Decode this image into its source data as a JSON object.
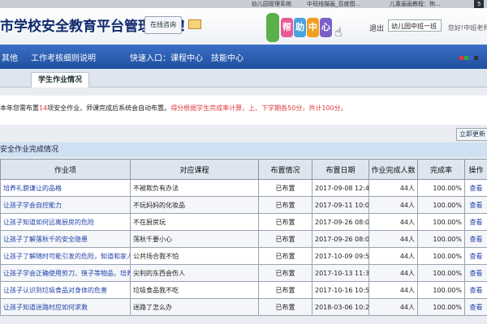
{
  "browser": {
    "tabs": [
      {
        "label": "幼儿园管理系统"
      },
      {
        "label": "中班线描画_百度图..."
      },
      {
        "label": "儿童画画教程：狗..."
      },
      {
        "label": "5"
      }
    ]
  },
  "header": {
    "title": "市学校安全教育平台管理系统！",
    "consult_label": "在线咨询",
    "help_letters": [
      "帮",
      "助",
      "中",
      "心"
    ],
    "logout_label": "退出",
    "kindergarten_select": "幼儿园中班一班",
    "welcome_text": "您好!中班老师"
  },
  "nav": {
    "items": [
      "其他",
      "工作考核细则说明"
    ],
    "quick_entry": "快速入口：课程中心　技能中心",
    "dot_colors": [
      "#e33",
      "#3a3",
      "#36c",
      "#333"
    ]
  },
  "subtab": {
    "active_label": "学生作业情况"
  },
  "notice": {
    "prefix": "本年您需布置",
    "count": "14",
    "middle": "项安全作业，师课完成后系统会自动布置。",
    "red_text": "得分根据学生完成率计算，上、下学期各50分，共计100分。"
  },
  "refresh_label": "立即更新",
  "section_title": "安全作业完成情况",
  "table": {
    "headers": [
      "作业项",
      "对应课程",
      "布置情况",
      "布置日期",
      "作业完成人数",
      "完成率",
      "操作"
    ],
    "rows": [
      [
        "培养礼貌谦让的品格",
        "不被欺负有办法",
        "已布置",
        "2017-09-08 12:49:0",
        "44人",
        "100.00%",
        "查看"
      ],
      [
        "让孩子学会自控能力",
        "不玩妈妈的化妆品",
        "已布置",
        "2017-09-11 10:07:1",
        "44人",
        "100.00%",
        "查看"
      ],
      [
        "让孩子知道如何远离厨房的危险",
        "不在厨房玩",
        "已布置",
        "2017-09-26 08:02:3",
        "44人",
        "100.00%",
        "查看"
      ],
      [
        "让孩子了解落秋千的安全隐患",
        "荡秋千要小心",
        "已布置",
        "2017-09-26 08:02:3",
        "44人",
        "100.00%",
        "查看"
      ],
      [
        "让孩子了解随时可能引发的危险，知道和家人走失",
        "公共场合我不怕",
        "已布置",
        "2017-10-09 09:52:3",
        "44人",
        "100.00%",
        "查看"
      ],
      [
        "让孩子学会正确使用剪刀、筷子等物品，培养好",
        "尖利的东西会伤人",
        "已布置",
        "2017-10-13 11:30:0",
        "44人",
        "100.00%",
        "查看"
      ],
      [
        "让孩子认识到垃圾食品对身体的危害",
        "垃圾食品我不吃",
        "已布置",
        "2017-10-16 10:57:2",
        "44人",
        "100.00%",
        "查看"
      ],
      [
        "让孩子知道迷路时应如何求救",
        "迷路了怎么办",
        "已布置",
        "2018-03-06 10:28:1",
        "44人",
        "100.00%",
        "查看"
      ]
    ]
  },
  "colors": {
    "nav_blue": "#2a5fb8",
    "notice_red": "#e03a3a",
    "link_blue": "#1f3fa8"
  }
}
